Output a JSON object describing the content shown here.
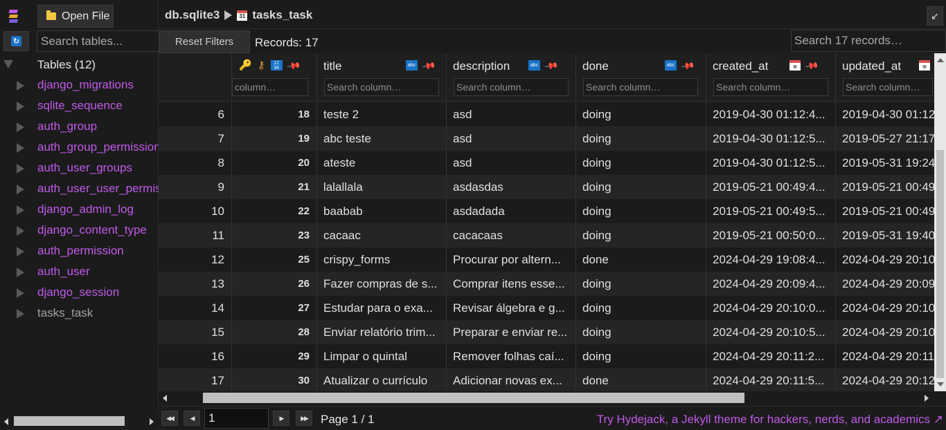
{
  "sidebar": {
    "open_file_label": "Open File",
    "search_placeholder": "Search tables...",
    "tables_header": "Tables (12)",
    "tables": [
      {
        "name": "django_migrations",
        "color": "#c05ae8"
      },
      {
        "name": "sqlite_sequence",
        "color": "#c05ae8"
      },
      {
        "name": "auth_group",
        "color": "#c05ae8"
      },
      {
        "name": "auth_group_permissions",
        "color": "#c05ae8"
      },
      {
        "name": "auth_user_groups",
        "color": "#c05ae8"
      },
      {
        "name": "auth_user_user_permissions",
        "color": "#c05ae8"
      },
      {
        "name": "django_admin_log",
        "color": "#c05ae8"
      },
      {
        "name": "django_content_type",
        "color": "#c05ae8"
      },
      {
        "name": "auth_permission",
        "color": "#c05ae8"
      },
      {
        "name": "auth_user",
        "color": "#c05ae8"
      },
      {
        "name": "django_session",
        "color": "#c05ae8"
      },
      {
        "name": "tasks_task",
        "color": "#a3a3a3"
      }
    ]
  },
  "header": {
    "db_name": "db.sqlite3",
    "table_name": "tasks_task",
    "calendar_glyph": "31",
    "expand_glyph": "↙"
  },
  "toolbar": {
    "reset_label": "Reset Filters",
    "records_label": "Records: 17",
    "records_search_placeholder": "Search 17 records…"
  },
  "columns": [
    {
      "key": "id",
      "title": "",
      "search_placeholder": "column…",
      "icons": [
        "key-icon",
        "key-outline-icon",
        "integer-type-icon",
        "pin-icon"
      ]
    },
    {
      "key": "title",
      "title": "title",
      "search_placeholder": "Search column…",
      "icons": [
        "text-type-icon",
        "pin-icon"
      ]
    },
    {
      "key": "description",
      "title": "description",
      "search_placeholder": "Search column…",
      "icons": [
        "text-type-icon",
        "pin-icon"
      ]
    },
    {
      "key": "done",
      "title": "done",
      "search_placeholder": "Search column…",
      "icons": [
        "text-type-icon",
        "pin-icon"
      ]
    },
    {
      "key": "created_at",
      "title": "created_at",
      "search_placeholder": "Search column…",
      "icons": [
        "datetime-type-icon",
        "pin-icon"
      ]
    },
    {
      "key": "updated_at",
      "title": "updated_at",
      "search_placeholder": "Search column…",
      "icons": [
        "datetime-type-icon"
      ]
    }
  ],
  "type_badges": {
    "text": "abc",
    "integer": "12 34"
  },
  "rows": [
    {
      "rn": "6",
      "id": "18",
      "title": "teste 2",
      "description": "asd",
      "done": "doing",
      "created_at": "2019-04-30 01:12:4...",
      "updated_at": "2019-04-30 01:12"
    },
    {
      "rn": "7",
      "id": "19",
      "title": "abc teste",
      "description": "asd",
      "done": "doing",
      "created_at": "2019-04-30 01:12:5...",
      "updated_at": "2019-05-27 21:17"
    },
    {
      "rn": "8",
      "id": "20",
      "title": "ateste",
      "description": "asd",
      "done": "doing",
      "created_at": "2019-04-30 01:12:5...",
      "updated_at": "2019-05-31 19:24"
    },
    {
      "rn": "9",
      "id": "21",
      "title": "lalallala",
      "description": "asdasdas",
      "done": "doing",
      "created_at": "2019-05-21 00:49:4...",
      "updated_at": "2019-05-21 00:49"
    },
    {
      "rn": "10",
      "id": "22",
      "title": "baabab",
      "description": "asdadada",
      "done": "doing",
      "created_at": "2019-05-21 00:49:5...",
      "updated_at": "2019-05-21 00:49"
    },
    {
      "rn": "11",
      "id": "23",
      "title": "cacaac",
      "description": "cacacaas",
      "done": "doing",
      "created_at": "2019-05-21 00:50:0...",
      "updated_at": "2019-05-31 19:40"
    },
    {
      "rn": "12",
      "id": "25",
      "title": "crispy_forms",
      "description": "Procurar por altern...",
      "done": "done",
      "created_at": "2024-04-29 19:08:4...",
      "updated_at": "2024-04-29 20:10"
    },
    {
      "rn": "13",
      "id": "26",
      "title": "Fazer compras de s...",
      "description": "Comprar itens esse...",
      "done": "doing",
      "created_at": "2024-04-29 20:09:4...",
      "updated_at": "2024-04-29 20:09"
    },
    {
      "rn": "14",
      "id": "27",
      "title": "Estudar para o exa...",
      "description": "Revisar álgebra e g...",
      "done": "doing",
      "created_at": "2024-04-29 20:10:0...",
      "updated_at": "2024-04-29 20:10"
    },
    {
      "rn": "15",
      "id": "28",
      "title": "Enviar relatório trim...",
      "description": "Preparar e enviar re...",
      "done": "doing",
      "created_at": "2024-04-29 20:10:5...",
      "updated_at": "2024-04-29 20:10"
    },
    {
      "rn": "16",
      "id": "29",
      "title": "Limpar o quintal",
      "description": "Remover folhas caí...",
      "done": "doing",
      "created_at": "2024-04-29 20:11:2...",
      "updated_at": "2024-04-29 20:11"
    },
    {
      "rn": "17",
      "id": "30",
      "title": "Atualizar o currículo",
      "description": "Adicionar novas ex...",
      "done": "done",
      "created_at": "2024-04-29 20:11:5...",
      "updated_at": "2024-04-29 20:12"
    }
  ],
  "pager": {
    "page_value": "1",
    "page_info": "Page 1 / 1",
    "promo": "Try Hydejack, a Jekyll theme for hackers, nerds, and academics ↗"
  },
  "colors": {
    "accent_purple": "#c05ae8",
    "type_blue": "#1a73c8",
    "pin_red": "#e64a3c",
    "key_gold": "#e6a43a"
  }
}
